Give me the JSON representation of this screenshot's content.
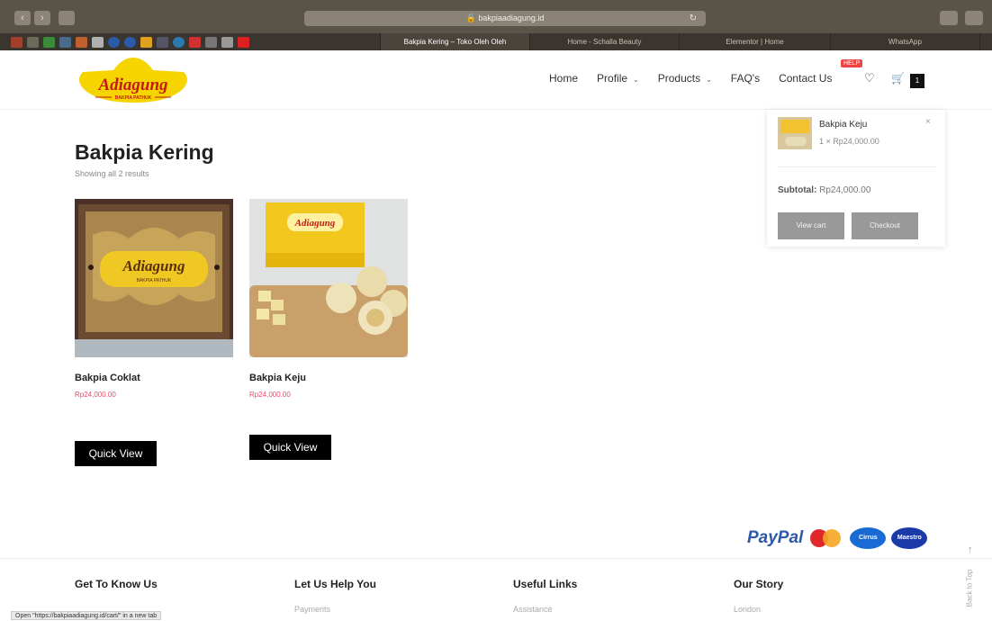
{
  "browser": {
    "url": "bakpiaadiagung.id",
    "tabs": [
      "Bakpia Kering – Toko Oleh Oleh",
      "Home - Schalla Beauty",
      "Elementor | Home",
      "WhatsApp"
    ],
    "status_tip": "Open \"https://bakpiaadiagung.id/cart/\" in a new tab"
  },
  "header": {
    "logo_text": "Adiagung",
    "logo_subtext": "BAKPIA PATHUK",
    "nav": [
      "Home",
      "Profile",
      "Products",
      "FAQ's",
      "Contact Us"
    ],
    "help_badge": "HELP",
    "cart_count": "1"
  },
  "mini_cart": {
    "item_name": "Bakpia Keju",
    "item_qty": "1 × Rp24,000.00",
    "close": "×",
    "subtotal_label": "Subtotal:",
    "subtotal_value": "Rp24,000.00",
    "view_cart": "View cart",
    "checkout": "Checkout"
  },
  "shop": {
    "title": "Bakpia Kering",
    "result_count": "Showing all 2 results",
    "products": [
      {
        "name": "Bakpia Coklat",
        "price": "Rp24,000.00",
        "quick_view": "Quick View",
        "box_text": "Adiagung",
        "box_sub": "BAKPIA PATHUK"
      },
      {
        "name": "Bakpia Keju",
        "price": "Rp24,000.00",
        "quick_view": "Quick View",
        "box_text": "Adiagung"
      }
    ]
  },
  "payments": [
    "PayPal",
    "MasterCard",
    "Cirrus",
    "Maestro"
  ],
  "back_to_top": "Back to Top",
  "footer": {
    "columns": [
      {
        "heading": "Get To Know Us",
        "link": ""
      },
      {
        "heading": "Let Us Help You",
        "link": "Payments"
      },
      {
        "heading": "Useful Links",
        "link": "Assistance"
      },
      {
        "heading": "Our Story",
        "link": "London"
      }
    ]
  },
  "colors": {
    "brand_yellow": "#f5d400",
    "logo_red": "#c21b16",
    "price": "#e0506a",
    "button": "#000000"
  }
}
